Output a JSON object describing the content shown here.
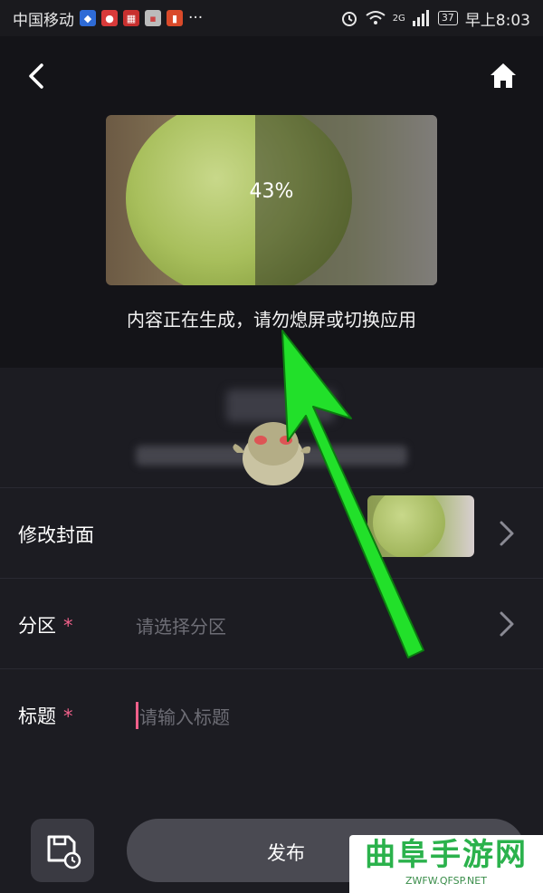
{
  "status_bar": {
    "carrier": "中国移动",
    "time": "早上8:03",
    "battery": "37",
    "network": "2G",
    "more": "···"
  },
  "preview": {
    "progress_text": "43%",
    "progress": 0.43
  },
  "generating_message": "内容正在生成，请勿熄屏或切换应用",
  "rows": {
    "cover": {
      "label": "修改封面"
    },
    "section": {
      "label": "分区",
      "required_mark": "*",
      "placeholder": "请选择分区"
    },
    "title": {
      "label": "标题",
      "required_mark": "*",
      "placeholder": "请输入标题"
    }
  },
  "bottom": {
    "publish_label": "发布"
  },
  "watermark": {
    "big": "曲阜手游网",
    "small": "ZWFW.QFSP.NET"
  },
  "icons": {
    "back": "chevron-left-icon",
    "home": "home-icon",
    "save": "save-draft-icon"
  },
  "colors": {
    "accent_pink": "#f0608a",
    "annotation_green": "#22e02a",
    "watermark_green": "#2bb24c"
  }
}
